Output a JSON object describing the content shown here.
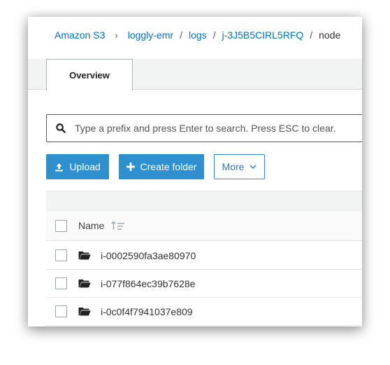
{
  "breadcrumb": {
    "items": [
      "Amazon S3",
      "loggly-emr",
      "logs",
      "j-3J5B5CIRL5RFQ",
      "node"
    ]
  },
  "tabs": [
    {
      "label": "Overview"
    }
  ],
  "search": {
    "placeholder": "Type a prefix and press Enter to search. Press ESC to clear."
  },
  "actions": {
    "upload_label": "Upload",
    "create_folder_label": "Create folder",
    "more_label": "More"
  },
  "table": {
    "header_name": "Name",
    "rows": [
      {
        "name": "i-0002590fa3ae80970"
      },
      {
        "name": "i-077f864ec39b7628e"
      },
      {
        "name": "i-0c0f4f7941037e809"
      }
    ]
  },
  "colors": {
    "accent": "#2e90cf",
    "link": "#0073bb"
  }
}
